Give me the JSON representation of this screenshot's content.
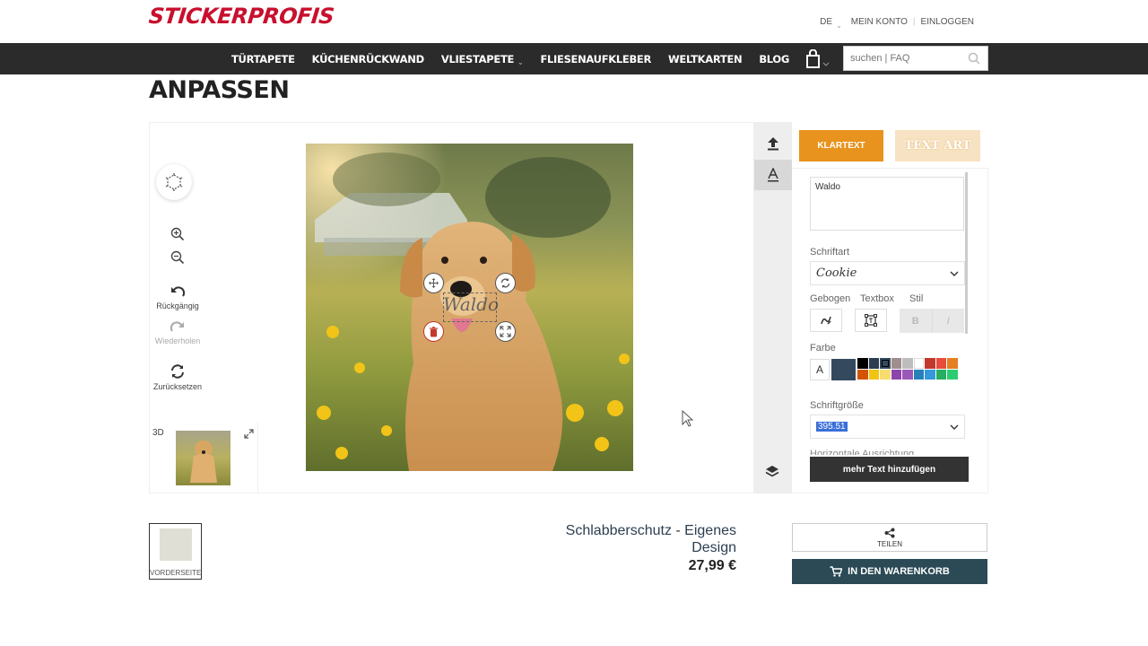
{
  "brand": {
    "logo_text": "STICKERPROFIS",
    "color": "#c8102e"
  },
  "top_links": {
    "language": "DE",
    "account": "MEIN KONTO",
    "login": "EINLOGGEN"
  },
  "nav": {
    "items": [
      "TÜRTAPETE",
      "KÜCHENRÜCKWAND",
      "VLIESTAPETE",
      "FLIESENAUFKLEBER",
      "WELTKARTEN",
      "BLOG"
    ],
    "search_placeholder": "suchen | FAQ"
  },
  "page_title": "ANPASSEN",
  "tools": {
    "undo": "Rückgängig",
    "redo": "Wiederholen",
    "reset": "Zurücksetzen",
    "preview_3d": "3D"
  },
  "canvas": {
    "text_value": "Waldo"
  },
  "panel": {
    "tab_plain": "KLARTEXT",
    "tab_art": "TEXT ART",
    "text_value": "Waldo",
    "font_label": "Schriftart",
    "font_value": "Cookie",
    "curved_label": "Gebogen",
    "textbox_label": "Textbox",
    "style_label": "Stil",
    "bold": "B",
    "italic": "I",
    "color_label": "Farbe",
    "color_a": "A",
    "current_color": "#34495e",
    "swatches": [
      "#000000",
      "#2c3e50",
      "#34495e",
      "#9e8e8e",
      "#bdbdbd",
      "#ffffff",
      "#c0392b",
      "#e74c3c",
      "#e67e22",
      "#d35400",
      "#f1c40f",
      "#f7dc6f",
      "#8e44ad",
      "#9b59b6",
      "#2980b9",
      "#3498db",
      "#27ae60",
      "#2ecc71"
    ],
    "size_label": "Schriftgröße",
    "size_value": "395.51",
    "cut_label": "Horizontale Ausrichtung",
    "add_text": "mehr Text hinzufügen"
  },
  "product": {
    "side_label": "VORDERSEITE",
    "name": "Schlabberschutz - Eigenes Design",
    "price": "27,99 €",
    "share": "TEILEN",
    "add_to_cart": "IN DEN WARENKORB"
  }
}
